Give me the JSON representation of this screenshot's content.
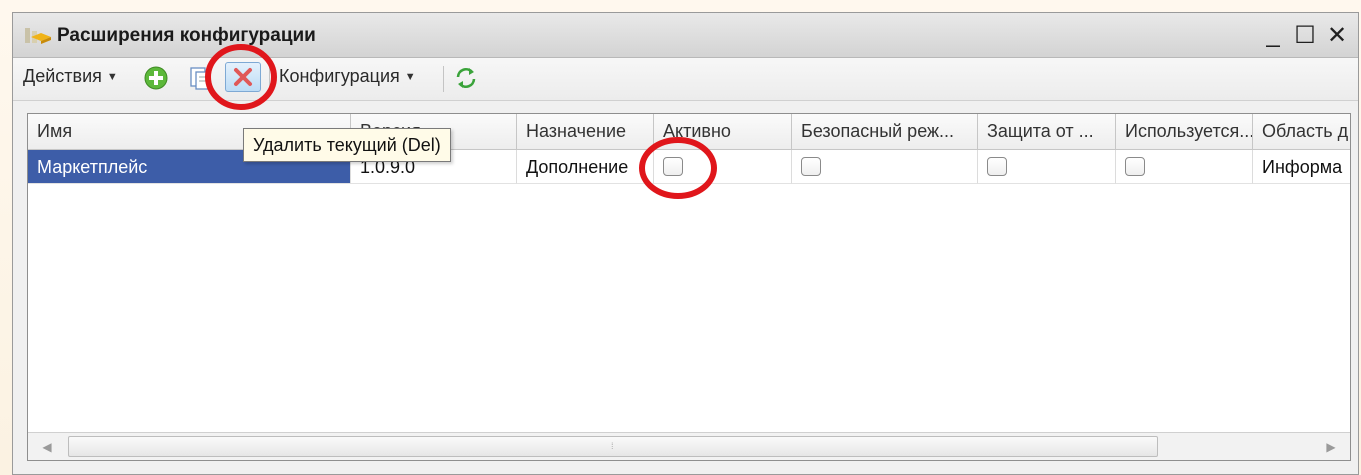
{
  "window": {
    "title": "Расширения конфигурации",
    "controls": {
      "minimize": "_",
      "maximize": "☐",
      "close": "✕"
    }
  },
  "toolbar": {
    "actions_label": "Действия",
    "configuration_label": "Конфигурация",
    "icons": [
      "add-icon",
      "copy-icon",
      "delete-icon",
      "refresh-icon"
    ]
  },
  "tooltip": {
    "text": "Удалить текущий (Del)"
  },
  "grid": {
    "columns": [
      "Имя",
      "Версия",
      "Назначение",
      "Активно",
      "Безопасный реж...",
      "Защита от ...",
      "Используется...",
      "Область д"
    ],
    "rows": [
      {
        "name": "Маркетплейс",
        "version": "1.0.9.0",
        "purpose": "Дополнение",
        "active": false,
        "safe_mode": false,
        "protection": false,
        "used": false,
        "area": "Информа"
      }
    ]
  },
  "colors": {
    "selection": "#3d5da8",
    "annotation_circle": "#e0161b",
    "tooltip_bg": "#fffbe8"
  }
}
